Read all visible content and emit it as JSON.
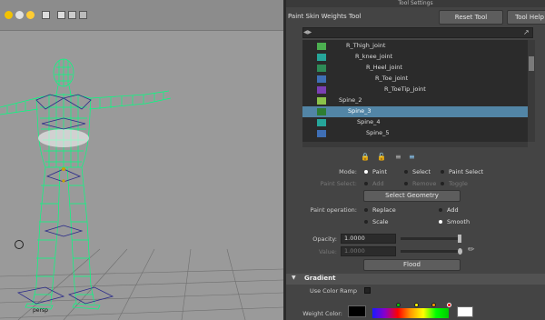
{
  "panel": {
    "title": "Tool Settings",
    "tool_name": "Paint Skin Weights Tool",
    "reset_tool": "Reset Tool",
    "tool_help": "Tool Help"
  },
  "viewport": {
    "camera_label": "persp"
  },
  "joints": [
    {
      "label": "R_Thigh_joint",
      "color": "#4caf50",
      "selected": false
    },
    {
      "label": "R_knee_joint",
      "color": "#26a69a",
      "selected": false
    },
    {
      "label": "R_Heel_joint",
      "color": "#2e8b57",
      "selected": false
    },
    {
      "label": "R_Toe_joint",
      "color": "#3f6fb5",
      "selected": false
    },
    {
      "label": "R_ToeTip_joint",
      "color": "#7b3fb5",
      "selected": false
    },
    {
      "label": "Spine_2",
      "color": "#8bc34a",
      "selected": false
    },
    {
      "label": "Spine_3",
      "color": "#2e7d32",
      "selected": true
    },
    {
      "label": "Spine_4",
      "color": "#26a69a",
      "selected": false
    },
    {
      "label": "Spine_5",
      "color": "#3f6fb5",
      "selected": false
    }
  ],
  "mode": {
    "label": "Mode:",
    "options": [
      "Paint",
      "Select",
      "Paint Select"
    ],
    "selected": "Paint"
  },
  "paint_select": {
    "label": "Paint Select:",
    "options": [
      "Add",
      "Remove",
      "Toggle"
    ]
  },
  "select_geometry": "Select Geometry",
  "paint_operation": {
    "label": "Paint operation:",
    "options": [
      "Replace",
      "Add",
      "Scale",
      "Smooth"
    ],
    "selected": "Smooth"
  },
  "opacity": {
    "label": "Opacity:",
    "value": "1.0000",
    "level": 1.0
  },
  "value": {
    "label": "Value:",
    "value": "1.0000",
    "level": 1.0
  },
  "flood": "Flood",
  "gradient": {
    "title": "Gradient",
    "use_color_ramp": "Use Color Ramp",
    "weight_color": "Weight Color:"
  },
  "colors": {
    "selection_highlight": "#5285a6",
    "wireframe": "#00ff80"
  }
}
